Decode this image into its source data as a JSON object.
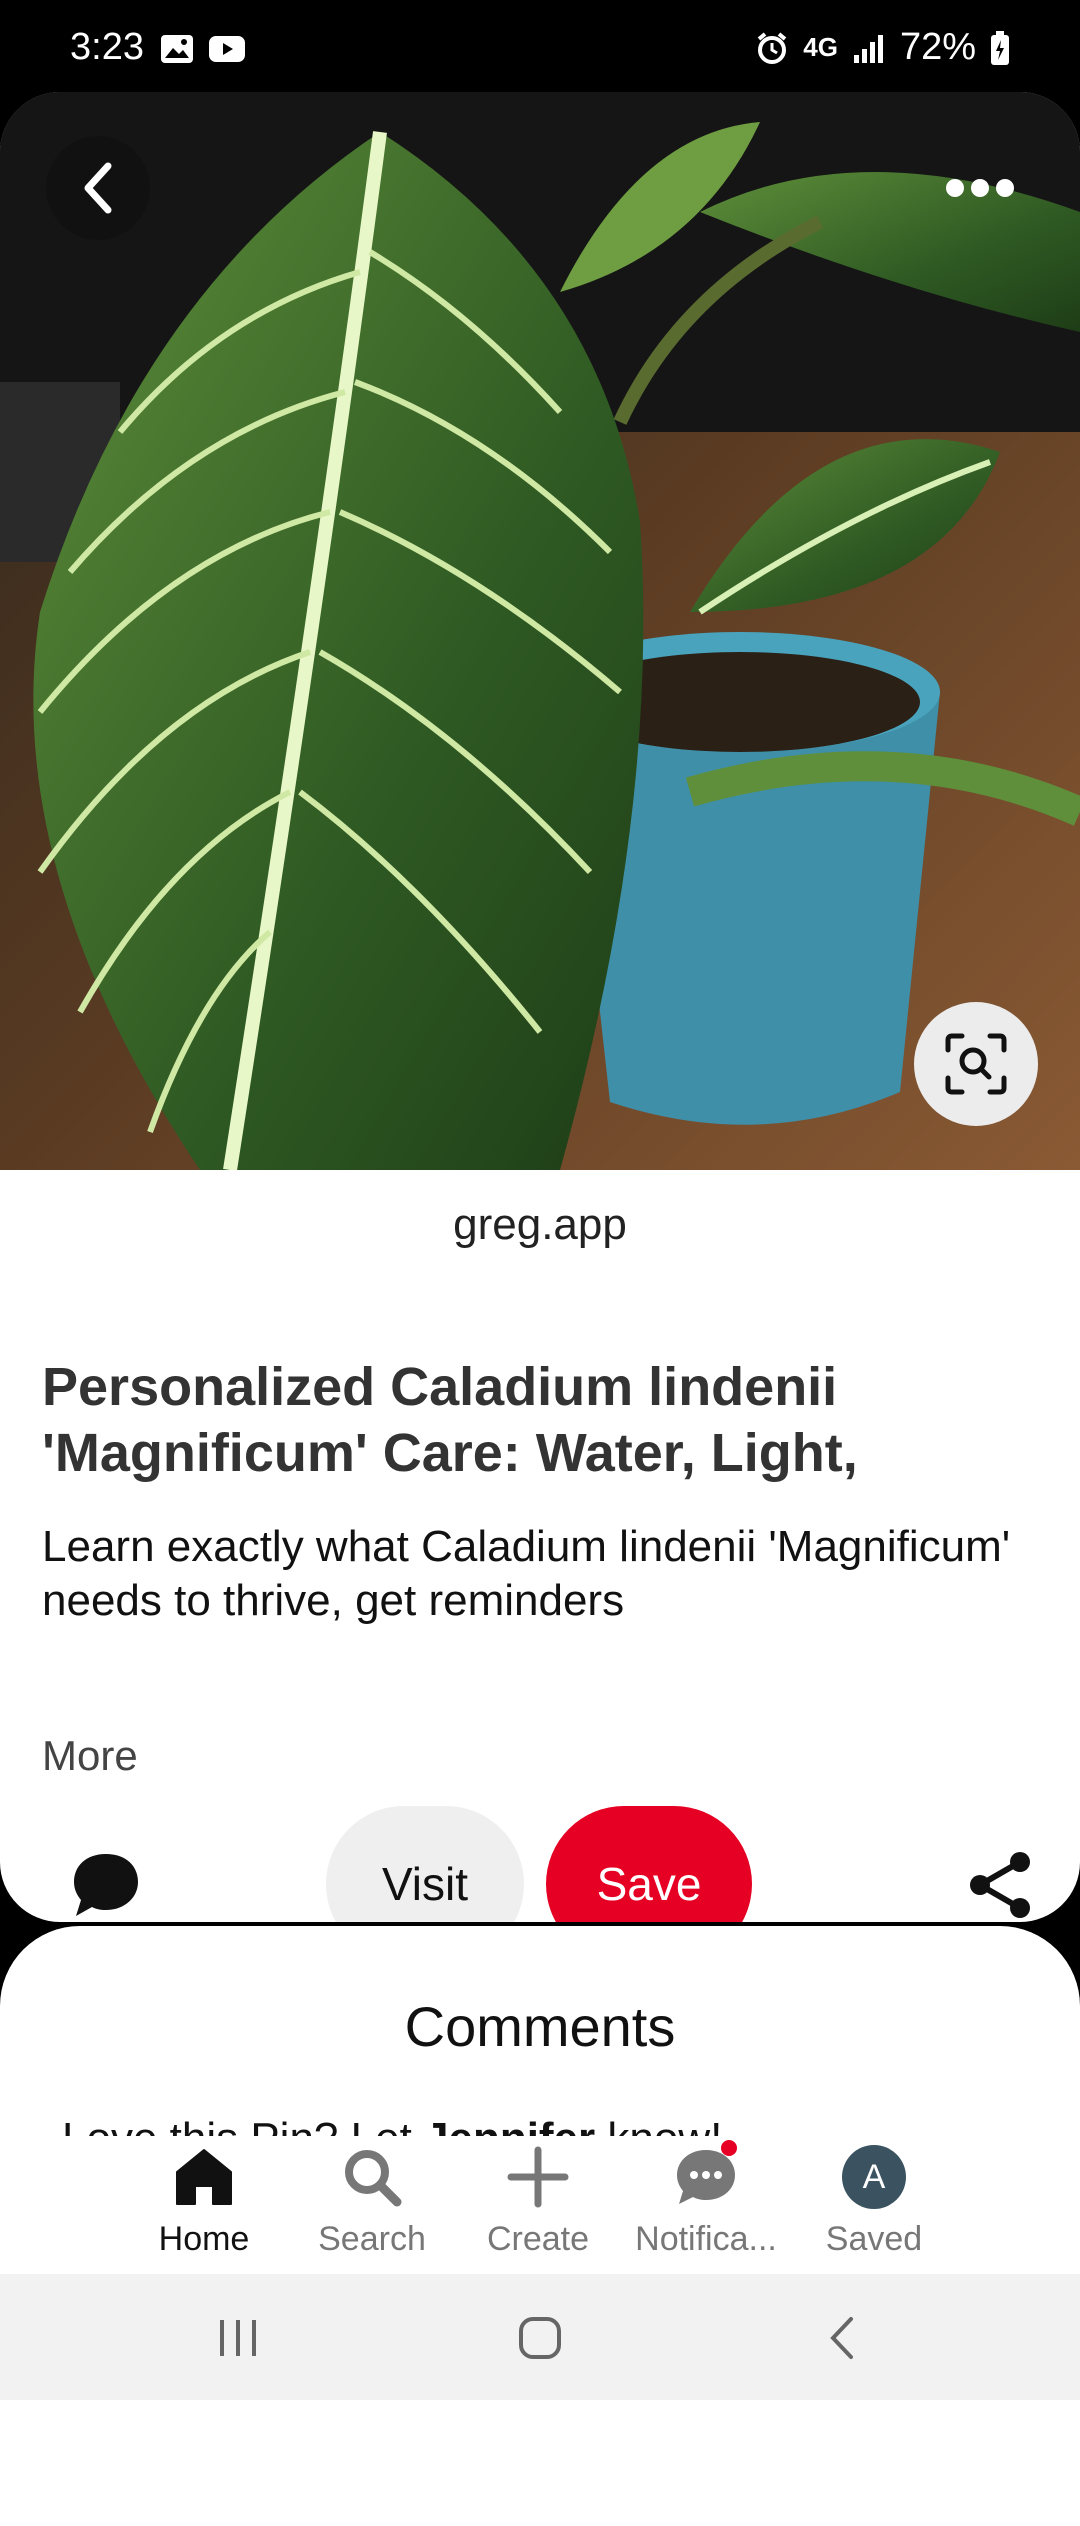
{
  "status_bar": {
    "time": "3:23",
    "network": "4G",
    "battery": "72%"
  },
  "pin": {
    "source": "greg.app",
    "title": "Personalized Caladium lindenii 'Magnificum' Care: Water, Light,",
    "description": "Learn exactly what Caladium lindenii 'Magnificum' needs to thrive, get reminders",
    "more_label": "More",
    "visit_label": "Visit",
    "save_label": "Save"
  },
  "comments": {
    "title": "Comments",
    "prompt_prefix": "Love this Pin? Let ",
    "prompt_name": "Jennifer",
    "prompt_suffix": " know!"
  },
  "nav": {
    "home": "Home",
    "search": "Search",
    "create": "Create",
    "notifications": "Notifica...",
    "saved": "Saved",
    "avatar_initial": "A"
  },
  "colors": {
    "save_red": "#e60023",
    "avatar_bg": "#3b5361"
  }
}
